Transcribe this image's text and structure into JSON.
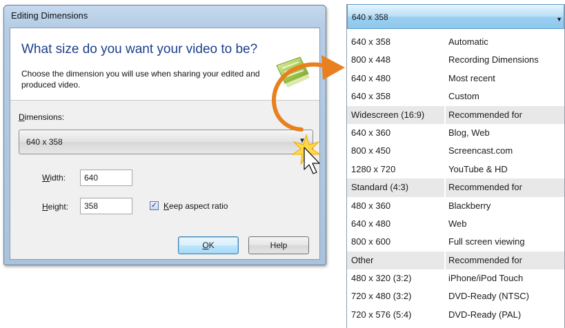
{
  "dialog": {
    "title": "Editing Dimensions",
    "heading": "What size do you want your video to be?",
    "description": "Choose the dimension you will use when sharing your edited and produced video.",
    "dimensions_label_first": "D",
    "dimensions_label_rest": "imensions:",
    "dimensions_value": "640 x 358",
    "width_label_first": "W",
    "width_label_rest": "idth:",
    "width_value": "640",
    "height_label_first": "H",
    "height_label_rest": "eight:",
    "height_value": "358",
    "keep_aspect_first": "K",
    "keep_aspect_rest": "eep aspect ratio",
    "keep_aspect_checked": true,
    "ok_first": "O",
    "ok_rest": "K",
    "help_label": "Help"
  },
  "dropdown": {
    "selected": "640 x 358",
    "rows": [
      {
        "c1": "640 x 358",
        "c2": "Automatic",
        "group": false
      },
      {
        "c1": "800 x 448",
        "c2": "Recording Dimensions",
        "group": false
      },
      {
        "c1": "640 x 480",
        "c2": "Most recent",
        "group": false
      },
      {
        "c1": "640 x 358",
        "c2": "Custom",
        "group": false
      },
      {
        "c1": "Widescreen (16:9)",
        "c2": "Recommended for",
        "group": true
      },
      {
        "c1": "640 x 360",
        "c2": "Blog, Web",
        "group": false
      },
      {
        "c1": "800 x 450",
        "c2": "Screencast.com",
        "group": false
      },
      {
        "c1": "1280 x 720",
        "c2": "YouTube & HD",
        "group": false
      },
      {
        "c1": "Standard (4:3)",
        "c2": "Recommended for",
        "group": true
      },
      {
        "c1": "480 x 360",
        "c2": "Blackberry",
        "group": false
      },
      {
        "c1": "640 x 480",
        "c2": "Web",
        "group": false
      },
      {
        "c1": "800 x 600",
        "c2": "Full screen viewing",
        "group": false
      },
      {
        "c1": "Other",
        "c2": "Recommended for",
        "group": true
      },
      {
        "c1": "480 x 320 (3:2)",
        "c2": "iPhone/iPod Touch",
        "group": false
      },
      {
        "c1": "720 x 480 (3:2)",
        "c2": "DVD-Ready (NTSC)",
        "group": false
      },
      {
        "c1": "720 x 576 (5:4)",
        "c2": "DVD-Ready (PAL)",
        "group": false
      }
    ]
  },
  "colors": {
    "accent_arrow": "#e8801f",
    "heading": "#1c3e8c"
  }
}
